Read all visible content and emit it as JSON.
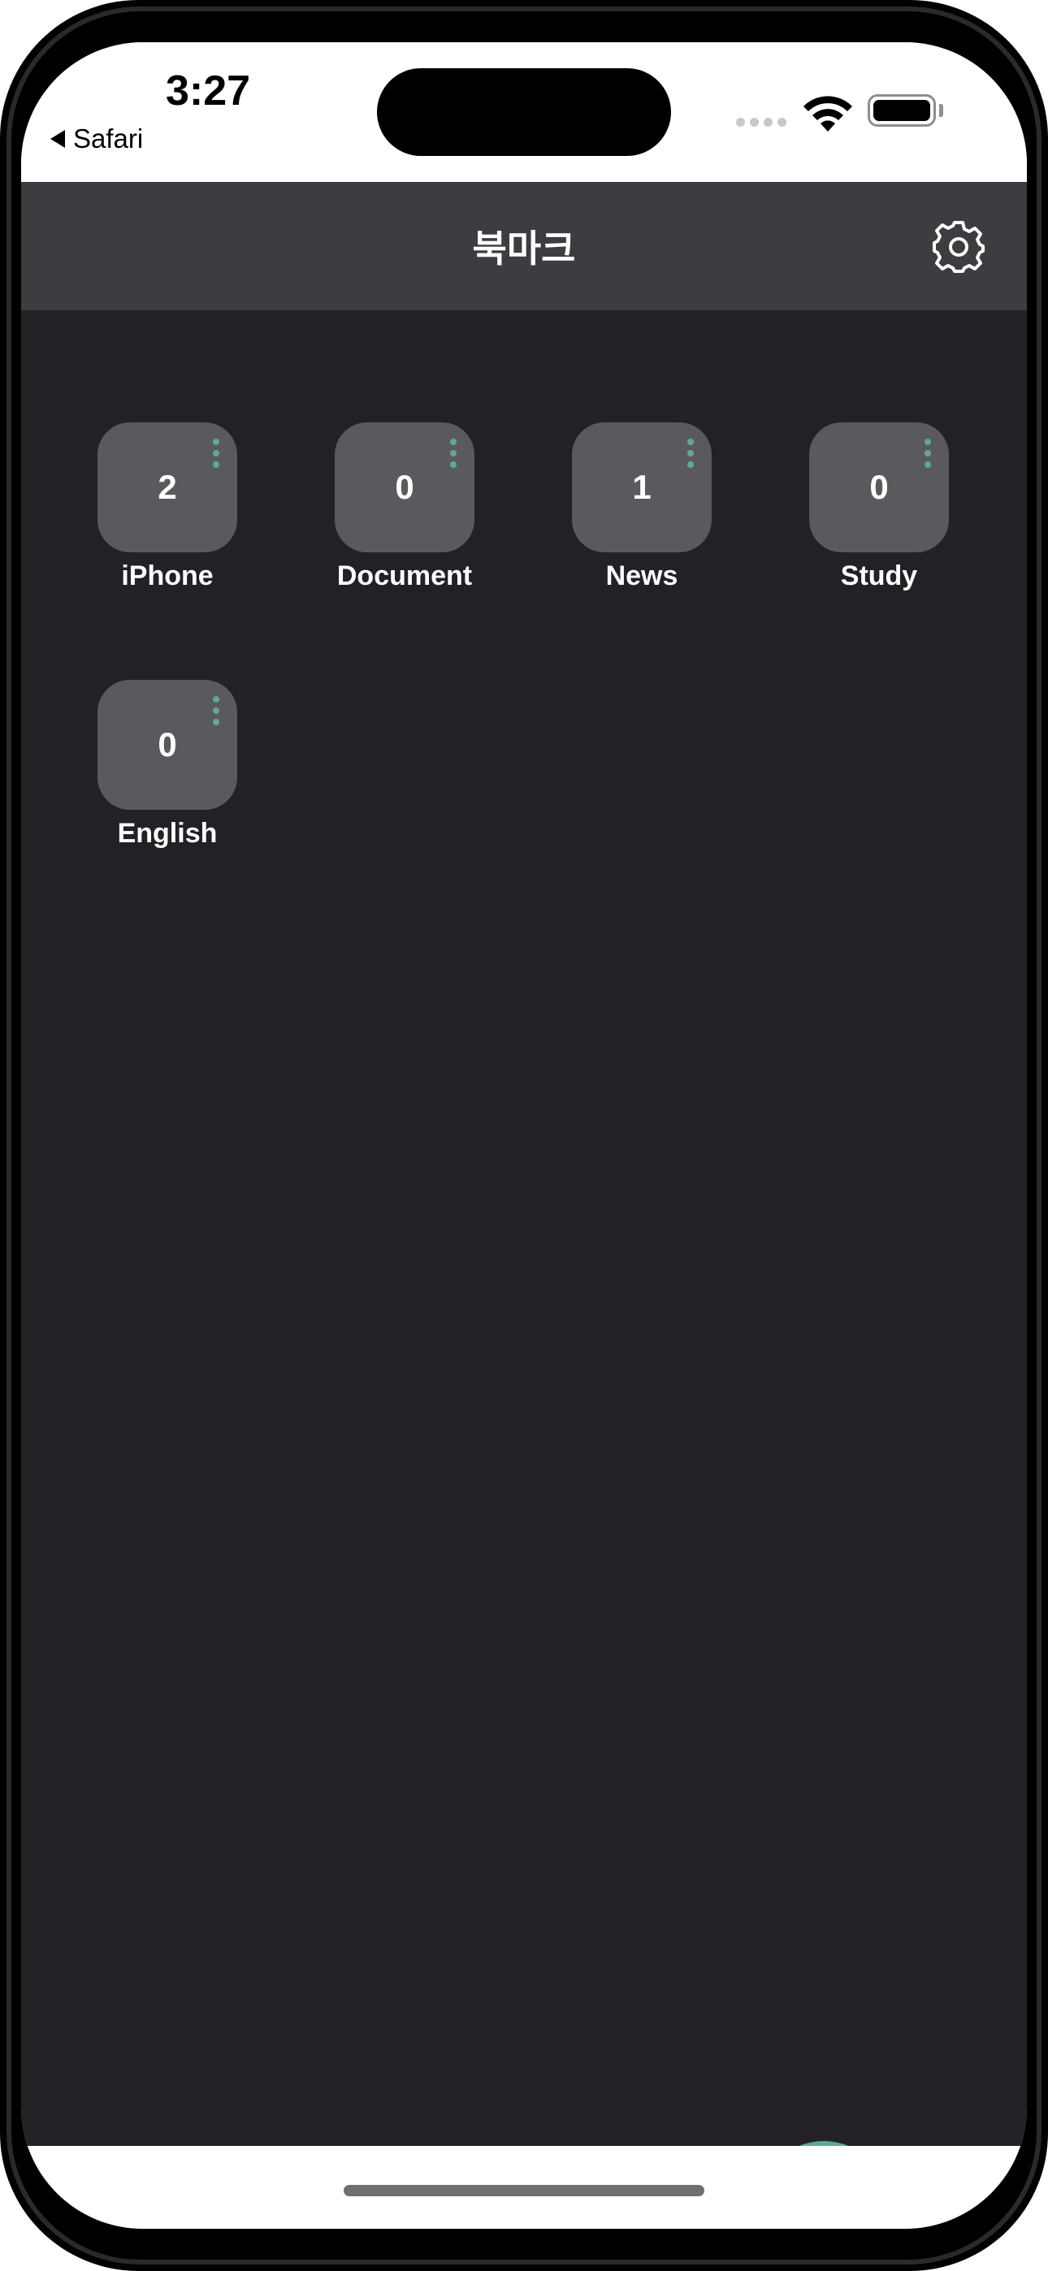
{
  "status_bar": {
    "time": "3:27",
    "back_app": "Safari",
    "icons": [
      "signal-icon",
      "wifi-icon",
      "battery-icon"
    ]
  },
  "nav": {
    "title": "북마크",
    "settings_icon": "gear-icon"
  },
  "folders": [
    {
      "name": "iPhone",
      "count": "2"
    },
    {
      "name": "Document",
      "count": "0"
    },
    {
      "name": "News",
      "count": "1"
    },
    {
      "name": "Study",
      "count": "0"
    },
    {
      "name": "English",
      "count": "0"
    }
  ],
  "fab": {
    "icon": "plus-icon"
  },
  "colors": {
    "accent": "#5fa898",
    "nav_background": "#3d3d41",
    "content_background": "#222226",
    "tile_background": "#5a5a5e"
  }
}
